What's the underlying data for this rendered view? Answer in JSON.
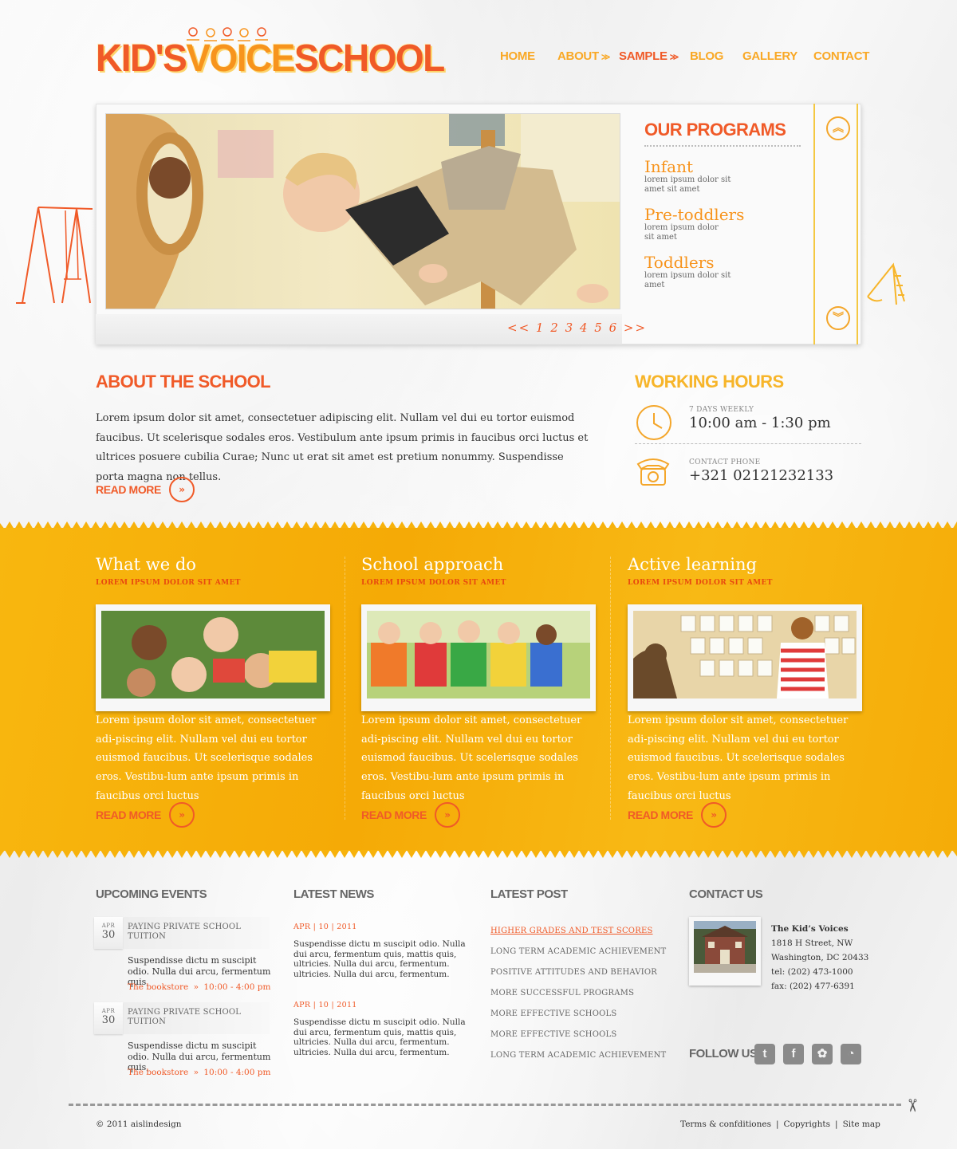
{
  "logo": {
    "part1": "KID'S",
    "part2": "VOICE",
    "part3": "SCHOOL"
  },
  "nav": {
    "items": [
      {
        "label": "HOME"
      },
      {
        "label": "ABOUT"
      },
      {
        "label": "SAMPLE"
      },
      {
        "label": "BLOG"
      },
      {
        "label": "GALLERY"
      },
      {
        "label": "CONTACT"
      }
    ],
    "active": "SAMPLE"
  },
  "slider": {
    "prev": "<<",
    "next": ">>",
    "pages": [
      "1",
      "2",
      "3",
      "4",
      "5",
      "6"
    ]
  },
  "programs": {
    "title": "OUR PROGRAMS",
    "items": [
      {
        "name": "Infant",
        "desc": "lorem ipsum dolor sit amet sit amet"
      },
      {
        "name": "Pre-toddlers",
        "desc": "lorem ipsum dolor sit amet"
      },
      {
        "name": "Toddlers",
        "desc": "lorem ipsum dolor sit amet"
      }
    ]
  },
  "about": {
    "title": "ABOUT THE SCHOOL",
    "body": "Lorem ipsum dolor sit amet, consectetuer adipiscing elit. Nullam vel dui eu tortor euismod faucibus. Ut scelerisque sodales eros. Vestibulum ante ipsum primis in faucibus orci luctus et ultrices posuere cubilia Curae; Nunc ut erat sit amet est pretium nonummy. Suspendisse porta magna non tellus.",
    "read_more": "READ MORE"
  },
  "hours": {
    "title": "WORKING HOURS",
    "label": "7 DAYS WEEKLY",
    "value": "10:00 am - 1:30 pm",
    "phone_label": "CONTACT PHONE",
    "phone": "+321 02121232133"
  },
  "columns": [
    {
      "title": "What we do",
      "subtitle": "LOREM IPSUM DOLOR SIT AMET",
      "body": "Lorem ipsum dolor sit amet, consectetuer adi-piscing elit. Nullam vel dui eu tortor euismod faucibus. Ut scelerisque sodales eros. Vestibu-lum ante ipsum primis in faucibus orci luctus",
      "read_more": "READ MORE"
    },
    {
      "title": "School approach",
      "subtitle": "LOREM IPSUM DOLOR SIT AMET",
      "body": "Lorem ipsum dolor sit amet, consectetuer adi-piscing elit. Nullam vel dui eu tortor euismod faucibus. Ut scelerisque sodales eros. Vestibu-lum ante ipsum primis in faucibus orci luctus",
      "read_more": "READ MORE"
    },
    {
      "title": "Active learning",
      "subtitle": "LOREM IPSUM DOLOR SIT AMET",
      "body": "Lorem ipsum dolor sit amet, consectetuer adi-piscing elit. Nullam vel dui eu tortor euismod faucibus. Ut scelerisque sodales eros. Vestibu-lum ante ipsum primis in faucibus orci luctus",
      "read_more": "READ MORE"
    }
  ],
  "events": {
    "title": "UPCOMING EVENTS",
    "items": [
      {
        "month": "APR",
        "day": "30",
        "title": "PAYING PRIVATE SCHOOL TUITION",
        "desc": "Suspendisse dictu m suscipit odio. Nulla dui arcu, fermentum quis,",
        "place": "The bookstore",
        "time": "10:00 - 4:00 pm"
      },
      {
        "month": "APR",
        "day": "30",
        "title": "PAYING PRIVATE SCHOOL TUITION",
        "desc": "Suspendisse dictu m suscipit odio. Nulla dui arcu, fermentum quis,",
        "place": "The bookstore",
        "time": "10:00 - 4:00 pm"
      }
    ]
  },
  "news": {
    "title": "LATEST NEWS",
    "items": [
      {
        "date": "APR | 10 | 2011",
        "body": "Suspendisse dictu m suscipit odio. Nulla dui arcu, fermentum quis, mattis quis, ultricies. Nulla dui arcu, fermentum. ultricies. Nulla dui arcu, fermentum."
      },
      {
        "date": "APR | 10 | 2011",
        "body": "Suspendisse dictu m suscipit odio. Nulla dui arcu, fermentum quis, mattis quis, ultricies. Nulla dui arcu, fermentum. ultricies. Nulla dui arcu, fermentum."
      }
    ]
  },
  "posts": {
    "title": "LATEST POST",
    "items": [
      "HIGHER GRADES AND TEST SCORES",
      "LONG TERM ACADEMIC ACHIEVEMENT",
      "POSITIVE ATTITUDES AND BEHAVIOR",
      "MORE SUCCESSFUL PROGRAMS",
      "MORE EFFECTIVE SCHOOLS",
      "MORE EFFECTIVE SCHOOLS",
      "LONG TERM ACADEMIC ACHIEVEMENT"
    ]
  },
  "contact": {
    "title": "CONTACT US",
    "name": "The Kid’s Voices",
    "street": "1818 H Street, NW",
    "city": "Washington, DC 20433",
    "tel": "tel: (202) 473-1000",
    "fax": "fax: (202) 477-6391"
  },
  "follow": {
    "label": "FOLLOW US"
  },
  "footer": {
    "copyright": "© 2011 aislindesign",
    "terms": "Terms & confditiones",
    "copyrights": "Copyrights",
    "sitemap": "Site map"
  },
  "colors": {
    "accent_orange": "#f05a28",
    "accent_yellow": "#f7b20b",
    "program_orange": "#f7941d"
  }
}
